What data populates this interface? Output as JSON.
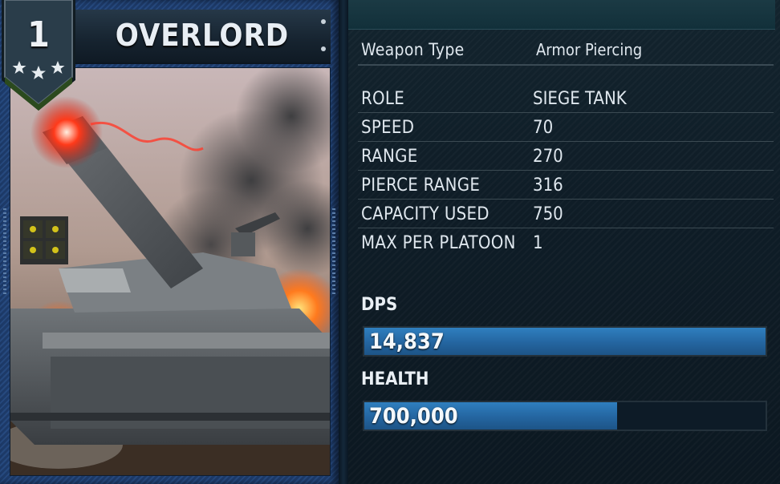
{
  "unit": {
    "name": "OVERLORD",
    "rank": "1",
    "stars": 3
  },
  "weapon": {
    "label": "Weapon Type",
    "value": "Armor Piercing"
  },
  "stats": [
    {
      "label": "ROLE",
      "value": "SIEGE TANK"
    },
    {
      "label": "SPEED",
      "value": "70"
    },
    {
      "label": "RANGE",
      "value": "270"
    },
    {
      "label": "PIERCE RANGE",
      "value": "316"
    },
    {
      "label": "CAPACITY USED",
      "value": "750"
    },
    {
      "label": "MAX PER PLATOON",
      "value": "1"
    }
  ],
  "dps": {
    "label": "DPS",
    "value": "14,837",
    "fill_fraction": 1.0
  },
  "health": {
    "label": "HEALTH",
    "value": "700,000",
    "fill_fraction": 0.63
  },
  "colors": {
    "bar_fill": "#2a72b0",
    "card_blue": "#223f70",
    "panel_bg": "#0f1d27",
    "text": "#dfe7ee"
  }
}
